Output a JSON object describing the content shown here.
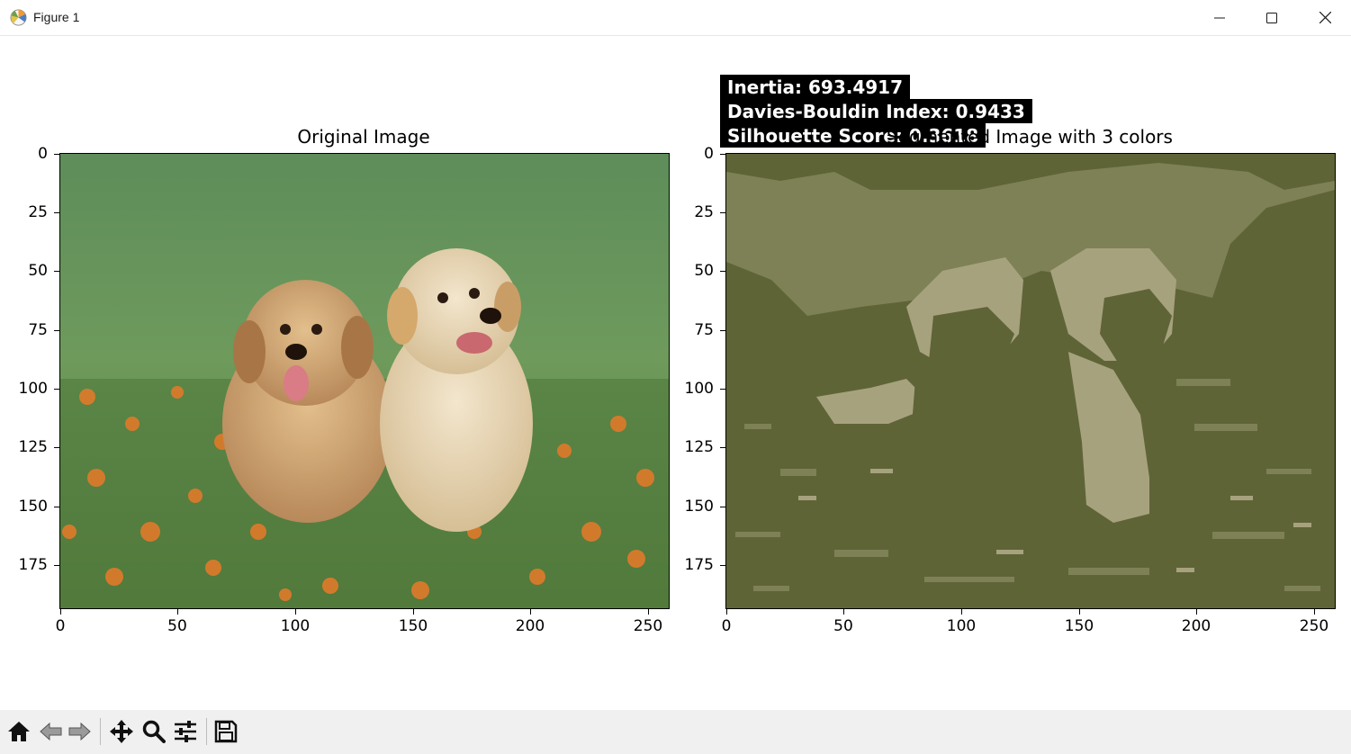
{
  "window": {
    "title": "Figure 1",
    "icon": "matplotlib-icon",
    "controls": [
      "minimize-icon",
      "maximize-icon",
      "close-icon"
    ]
  },
  "metrics": {
    "inertia": "Inertia: 693.4917",
    "davies_bouldin": "Davies-Bouldin Index: 0.9433",
    "silhouette": "Silhouette Score: 0.3618"
  },
  "left_axes": {
    "title": "Original Image",
    "yticks": [
      "0",
      "25",
      "50",
      "75",
      "100",
      "125",
      "150",
      "175"
    ],
    "xticks": [
      "0",
      "50",
      "100",
      "150",
      "200",
      "250"
    ],
    "image": "photo of two golden retriever puppies sitting in grass with orange flowers"
  },
  "right_axes": {
    "title": "Segmented Image with 3 colors",
    "yticks": [
      "0",
      "25",
      "50",
      "75",
      "100",
      "125",
      "150",
      "175"
    ],
    "xticks": [
      "0",
      "50",
      "100",
      "150",
      "200",
      "250"
    ],
    "palette": [
      "#5f6437",
      "#7e8155",
      "#a6a27e"
    ]
  },
  "toolbar": {
    "buttons": [
      "home-icon",
      "back-icon",
      "forward-icon",
      "pan-icon",
      "zoom-icon",
      "configure-subplots-icon",
      "save-icon"
    ]
  }
}
